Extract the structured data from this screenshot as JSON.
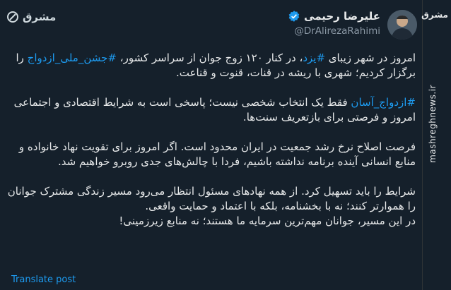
{
  "author": {
    "name": "علیرضا رحیمی",
    "handle": "@DrAlirezaRahimi"
  },
  "watermark": {
    "logo_text": "مشرق",
    "side_logo": "مشرق",
    "side_url": "mashreghnews.ir"
  },
  "tweet": {
    "p1_a": "امروز در شهر زیبای ",
    "p1_tag1": "#یزد",
    "p1_b": "، در کنار ۱۲۰ زوج جوان از سراسر کشور، ",
    "p1_tag2": "#جشن_ملی_ازدواج",
    "p1_c": " را برگزار کردیم؛ شهری با ریشه در قنات، قنوت و قناعت.",
    "p2_tag": "#ازدواج_آسان",
    "p2_a": " فقط یک انتخاب شخصی نیست؛ پاسخی است به شرایط اقتصادی و اجتماعی امروز و فرصتی برای بازتعریف سنت‌ها.",
    "p3": "فرصت اصلاح نرخ رشد جمعیت در ایران محدود است. اگر امروز برای تقویت نهاد خانواده و منابع انسانی آینده برنامه نداشته باشیم، فردا با چالش‌های جدی روبرو خواهیم شد.",
    "p4_a": "شرایط را باید تسهیل کرد. از همه نهادهای مسئول انتظار می‌رود مسیر زندگی مشترک جوانان را هموارتر کنند؛ نه با بخشنامه، بلکه با اعتماد و حمایت واقعی.",
    "p4_b": "در این مسیر، جوانان مهم‌ترین سرمایه ما هستند؛ نه منابع زیرزمینی!"
  },
  "translate_label": "Translate post",
  "colors": {
    "background": "#15202b",
    "link": "#1d9bf0",
    "text": "#e7e9ea",
    "secondary": "#8b98a5",
    "verified": "#1d9bf0"
  }
}
